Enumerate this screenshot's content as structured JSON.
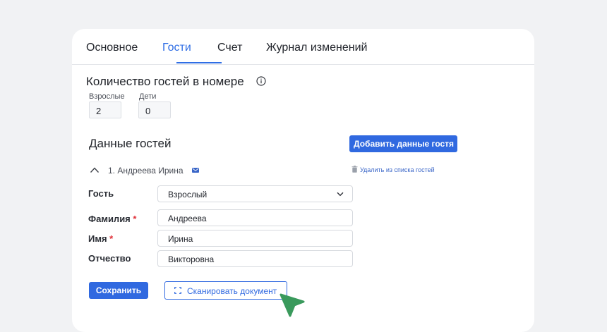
{
  "tabs": [
    {
      "label": "Основное",
      "active": false
    },
    {
      "label": "Гости",
      "active": true
    },
    {
      "label": "Счет",
      "active": false
    },
    {
      "label": "Журнал изменений",
      "active": false
    }
  ],
  "guest_count": {
    "title": "Количество гостей в номере",
    "adults_label": "Взрослые",
    "adults_value": "2",
    "children_label": "Дети",
    "children_value": "0"
  },
  "guests": {
    "title": "Данные гостей",
    "add_button": "Добавить данные гостя",
    "entry_name": "1. Андреева Ирина",
    "remove_link": "Удалить из списка гостей"
  },
  "form": {
    "guest_label": "Гость",
    "guest_value": "Взрослый",
    "surname_label": "Фамилия",
    "surname_value": "Андреева",
    "name_label": "Имя",
    "name_value": "Ирина",
    "patronymic_label": "Отчество",
    "patronymic_value": "Викторовна",
    "required_mark": "*"
  },
  "actions": {
    "save": "Сохранить",
    "scan": "Сканировать документ"
  },
  "colors": {
    "accent": "#3069e0",
    "required": "#e0323a",
    "cursor": "#3a9a5c"
  }
}
